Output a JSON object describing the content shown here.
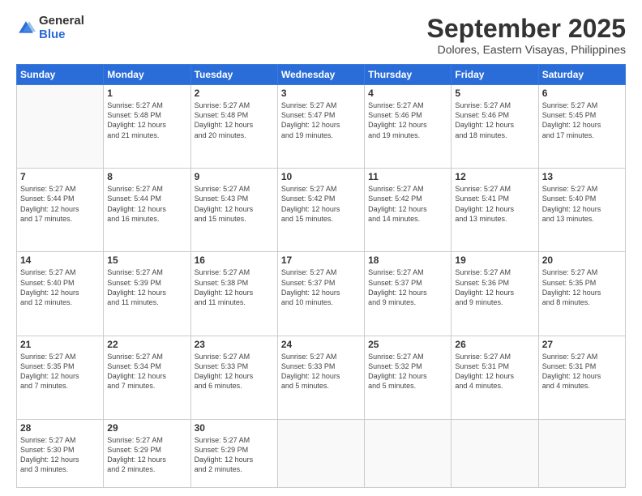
{
  "logo": {
    "general": "General",
    "blue": "Blue"
  },
  "header": {
    "month": "September 2025",
    "location": "Dolores, Eastern Visayas, Philippines"
  },
  "weekdays": [
    "Sunday",
    "Monday",
    "Tuesday",
    "Wednesday",
    "Thursday",
    "Friday",
    "Saturday"
  ],
  "weeks": [
    [
      {
        "day": "",
        "info": ""
      },
      {
        "day": "1",
        "info": "Sunrise: 5:27 AM\nSunset: 5:48 PM\nDaylight: 12 hours\nand 21 minutes."
      },
      {
        "day": "2",
        "info": "Sunrise: 5:27 AM\nSunset: 5:48 PM\nDaylight: 12 hours\nand 20 minutes."
      },
      {
        "day": "3",
        "info": "Sunrise: 5:27 AM\nSunset: 5:47 PM\nDaylight: 12 hours\nand 19 minutes."
      },
      {
        "day": "4",
        "info": "Sunrise: 5:27 AM\nSunset: 5:46 PM\nDaylight: 12 hours\nand 19 minutes."
      },
      {
        "day": "5",
        "info": "Sunrise: 5:27 AM\nSunset: 5:46 PM\nDaylight: 12 hours\nand 18 minutes."
      },
      {
        "day": "6",
        "info": "Sunrise: 5:27 AM\nSunset: 5:45 PM\nDaylight: 12 hours\nand 17 minutes."
      }
    ],
    [
      {
        "day": "7",
        "info": "Sunrise: 5:27 AM\nSunset: 5:44 PM\nDaylight: 12 hours\nand 17 minutes."
      },
      {
        "day": "8",
        "info": "Sunrise: 5:27 AM\nSunset: 5:44 PM\nDaylight: 12 hours\nand 16 minutes."
      },
      {
        "day": "9",
        "info": "Sunrise: 5:27 AM\nSunset: 5:43 PM\nDaylight: 12 hours\nand 15 minutes."
      },
      {
        "day": "10",
        "info": "Sunrise: 5:27 AM\nSunset: 5:42 PM\nDaylight: 12 hours\nand 15 minutes."
      },
      {
        "day": "11",
        "info": "Sunrise: 5:27 AM\nSunset: 5:42 PM\nDaylight: 12 hours\nand 14 minutes."
      },
      {
        "day": "12",
        "info": "Sunrise: 5:27 AM\nSunset: 5:41 PM\nDaylight: 12 hours\nand 13 minutes."
      },
      {
        "day": "13",
        "info": "Sunrise: 5:27 AM\nSunset: 5:40 PM\nDaylight: 12 hours\nand 13 minutes."
      }
    ],
    [
      {
        "day": "14",
        "info": "Sunrise: 5:27 AM\nSunset: 5:40 PM\nDaylight: 12 hours\nand 12 minutes."
      },
      {
        "day": "15",
        "info": "Sunrise: 5:27 AM\nSunset: 5:39 PM\nDaylight: 12 hours\nand 11 minutes."
      },
      {
        "day": "16",
        "info": "Sunrise: 5:27 AM\nSunset: 5:38 PM\nDaylight: 12 hours\nand 11 minutes."
      },
      {
        "day": "17",
        "info": "Sunrise: 5:27 AM\nSunset: 5:37 PM\nDaylight: 12 hours\nand 10 minutes."
      },
      {
        "day": "18",
        "info": "Sunrise: 5:27 AM\nSunset: 5:37 PM\nDaylight: 12 hours\nand 9 minutes."
      },
      {
        "day": "19",
        "info": "Sunrise: 5:27 AM\nSunset: 5:36 PM\nDaylight: 12 hours\nand 9 minutes."
      },
      {
        "day": "20",
        "info": "Sunrise: 5:27 AM\nSunset: 5:35 PM\nDaylight: 12 hours\nand 8 minutes."
      }
    ],
    [
      {
        "day": "21",
        "info": "Sunrise: 5:27 AM\nSunset: 5:35 PM\nDaylight: 12 hours\nand 7 minutes."
      },
      {
        "day": "22",
        "info": "Sunrise: 5:27 AM\nSunset: 5:34 PM\nDaylight: 12 hours\nand 7 minutes."
      },
      {
        "day": "23",
        "info": "Sunrise: 5:27 AM\nSunset: 5:33 PM\nDaylight: 12 hours\nand 6 minutes."
      },
      {
        "day": "24",
        "info": "Sunrise: 5:27 AM\nSunset: 5:33 PM\nDaylight: 12 hours\nand 5 minutes."
      },
      {
        "day": "25",
        "info": "Sunrise: 5:27 AM\nSunset: 5:32 PM\nDaylight: 12 hours\nand 5 minutes."
      },
      {
        "day": "26",
        "info": "Sunrise: 5:27 AM\nSunset: 5:31 PM\nDaylight: 12 hours\nand 4 minutes."
      },
      {
        "day": "27",
        "info": "Sunrise: 5:27 AM\nSunset: 5:31 PM\nDaylight: 12 hours\nand 4 minutes."
      }
    ],
    [
      {
        "day": "28",
        "info": "Sunrise: 5:27 AM\nSunset: 5:30 PM\nDaylight: 12 hours\nand 3 minutes."
      },
      {
        "day": "29",
        "info": "Sunrise: 5:27 AM\nSunset: 5:29 PM\nDaylight: 12 hours\nand 2 minutes."
      },
      {
        "day": "30",
        "info": "Sunrise: 5:27 AM\nSunset: 5:29 PM\nDaylight: 12 hours\nand 2 minutes."
      },
      {
        "day": "",
        "info": ""
      },
      {
        "day": "",
        "info": ""
      },
      {
        "day": "",
        "info": ""
      },
      {
        "day": "",
        "info": ""
      }
    ]
  ]
}
